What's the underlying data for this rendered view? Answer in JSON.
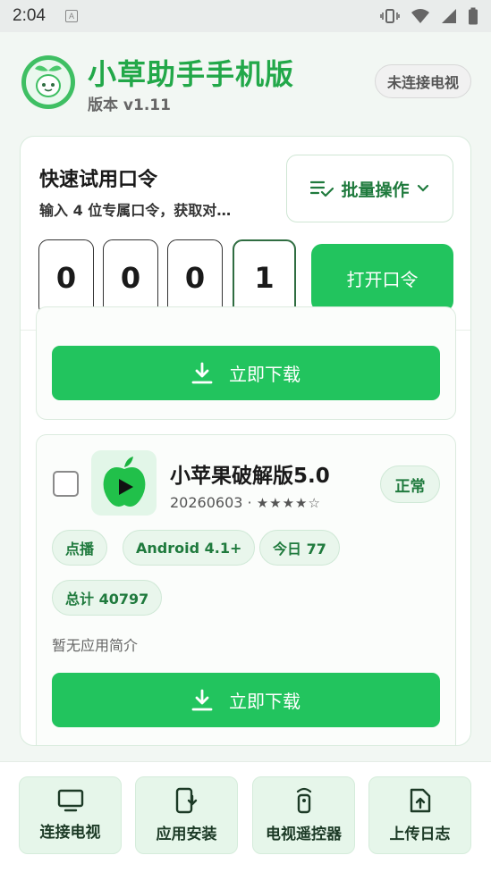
{
  "status_bar": {
    "time": "2:04",
    "notification_letter": "A"
  },
  "header": {
    "title": "小草助手手机版",
    "version": "版本 v1.11",
    "tv_status": "未连接电视"
  },
  "quick_code": {
    "title": "快速试用口令",
    "description": "输入 4 位专属口令，获取对…",
    "batch_label": "批量操作",
    "digits": [
      "0",
      "0",
      "0",
      "1"
    ],
    "open_label": "打开口令"
  },
  "items": [
    {
      "download_label": "立即下载"
    },
    {
      "name": "小苹果破解版5.0",
      "meta_date": "20260603",
      "meta_sep": "·",
      "stars": "★★★★☆",
      "status": "正常",
      "tags": [
        "点播",
        "Android 4.1+",
        "今日 77",
        "总计 40797"
      ],
      "intro": "暂无应用简介",
      "download_label": "立即下载"
    }
  ],
  "bottom_nav": [
    {
      "label": "连接电视",
      "icon": "tv-icon"
    },
    {
      "label": "应用安装",
      "icon": "phone-download-icon"
    },
    {
      "label": "电视遥控器",
      "icon": "remote-icon"
    },
    {
      "label": "上传日志",
      "icon": "upload-file-icon"
    }
  ],
  "colors": {
    "accent": "#22c45e",
    "title_green": "#22a849",
    "dark_green": "#1f7a3d"
  }
}
